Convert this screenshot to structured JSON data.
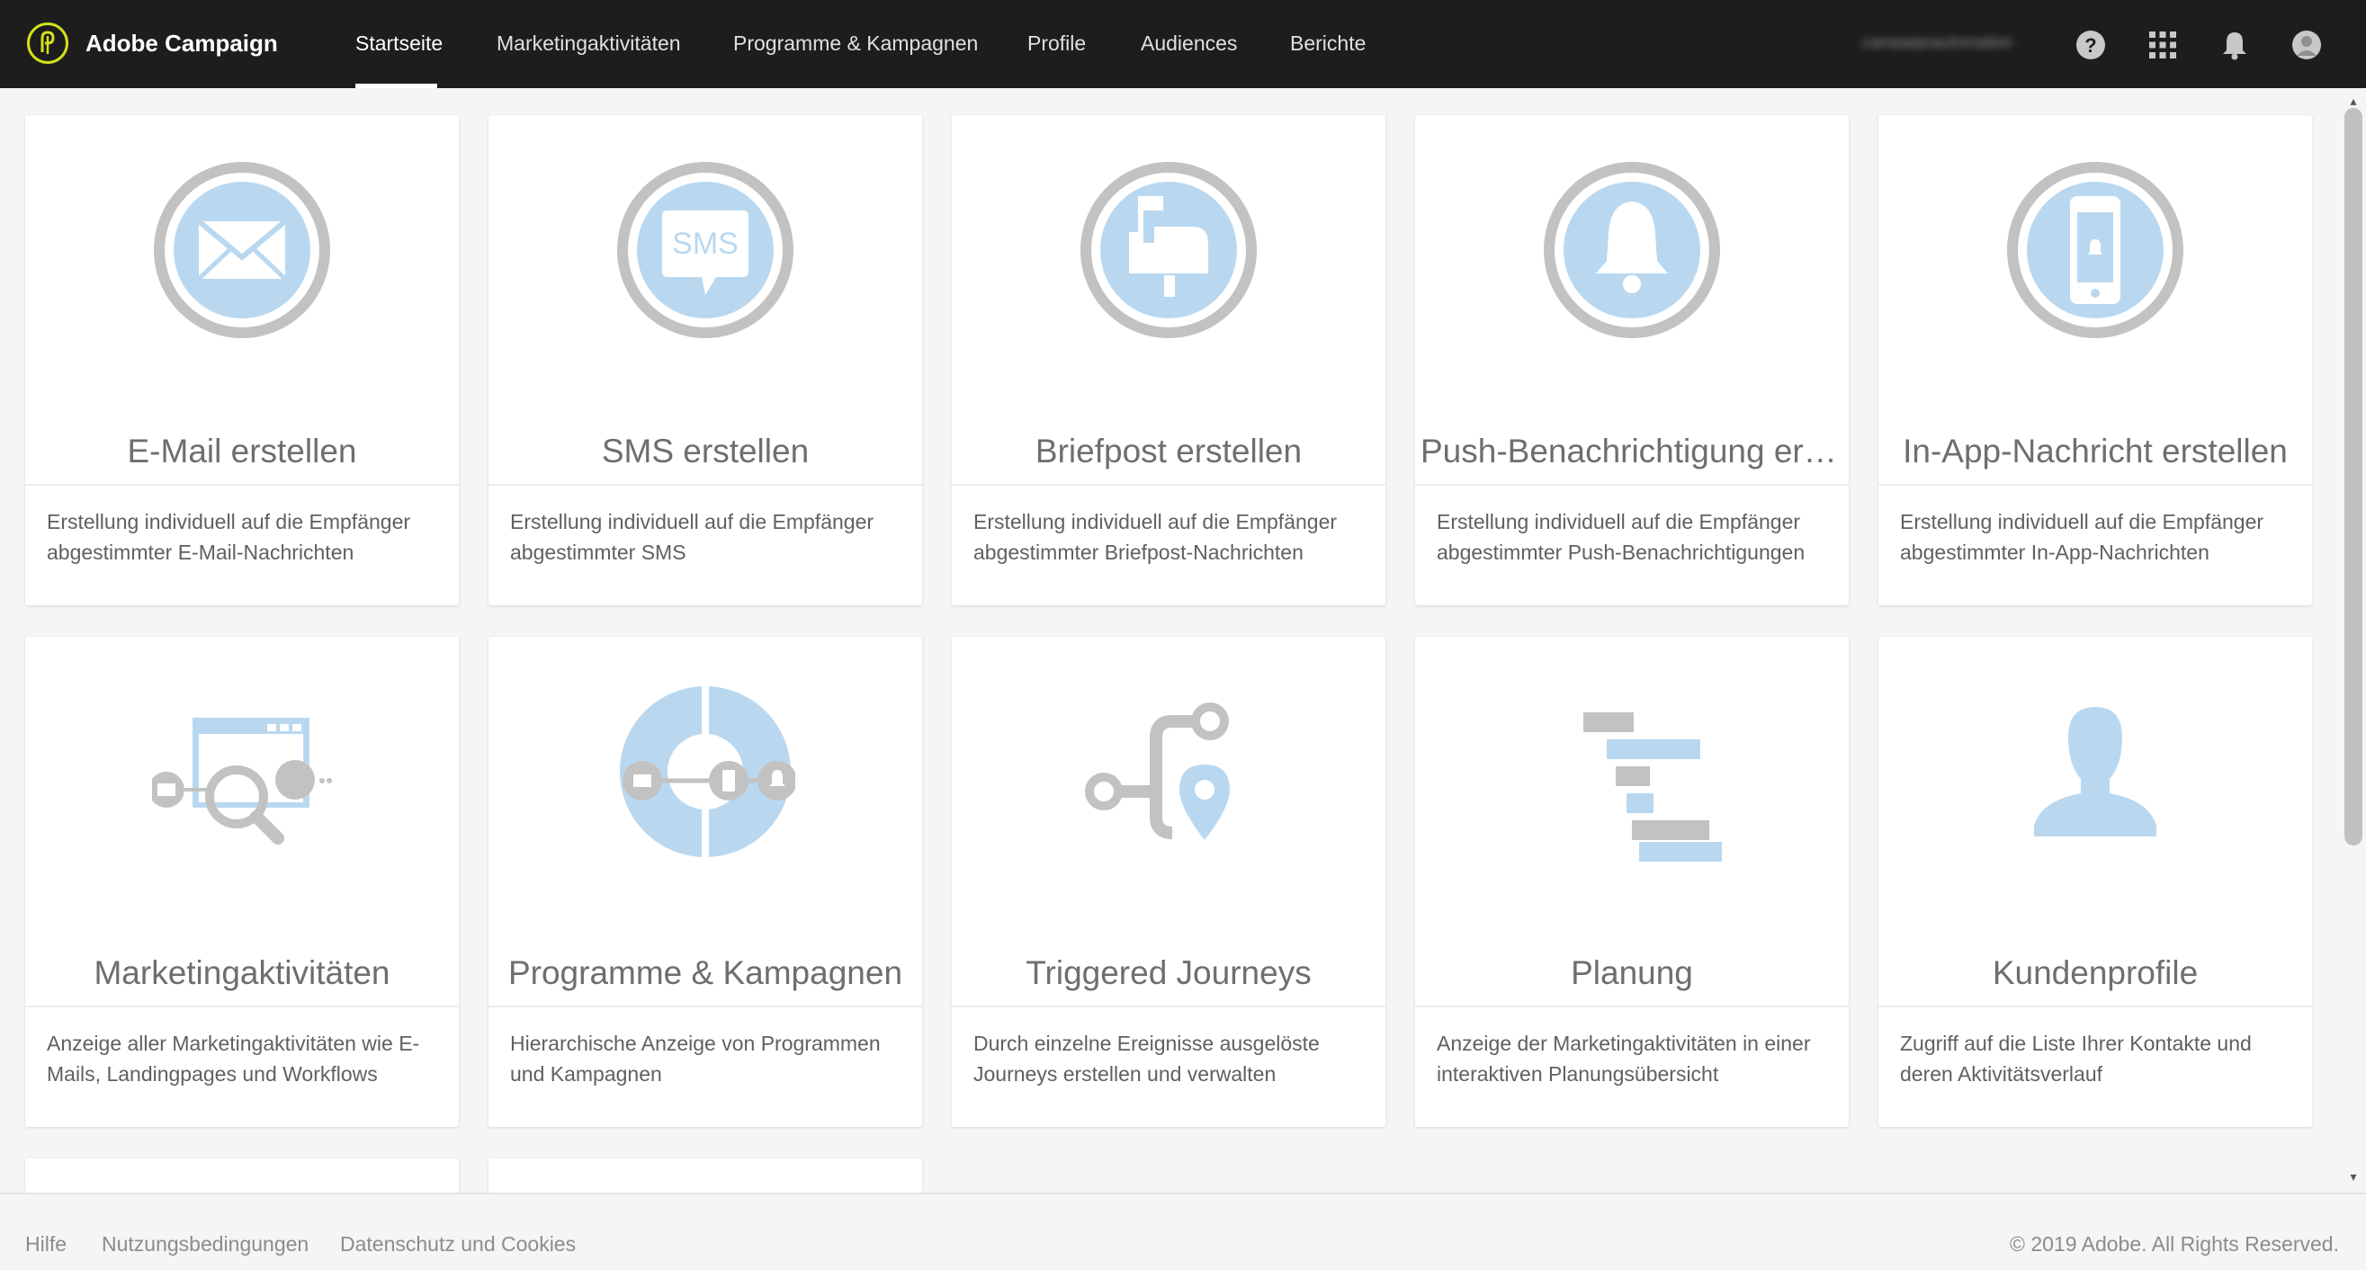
{
  "header": {
    "brand": "Adobe Campaign",
    "nav": [
      {
        "label": "Startseite",
        "active": true
      },
      {
        "label": "Marketingaktivitäten"
      },
      {
        "label": "Programme & Kampagnen"
      },
      {
        "label": "Profile"
      },
      {
        "label": "Audiences"
      },
      {
        "label": "Berichte"
      }
    ],
    "org_name": "campaignautomation",
    "icons": [
      "help-icon",
      "apps-grid-icon",
      "notification-bell-icon",
      "user-avatar-icon"
    ]
  },
  "cards": [
    {
      "title": "E-Mail erstellen",
      "description": "Erstellung individuell auf die Empfänger abgestimmter E-Mail-Nachrichten",
      "icon": "email-icon"
    },
    {
      "title": "SMS erstellen",
      "description": "Erstellung individuell auf die Empfänger abgestimmter SMS",
      "icon": "sms-icon",
      "icon_text": "SMS"
    },
    {
      "title": "Briefpost erstellen",
      "description": "Erstellung individuell auf die Empfänger abgestimmter Briefpost-Nachrichten",
      "icon": "mailbox-icon"
    },
    {
      "title": "Push-Benachrichtigung erstellen",
      "description": "Erstellung individuell auf die Empfänger abgestimmter Push-Benachrichtigungen",
      "icon": "push-bell-icon"
    },
    {
      "title": "In-App-Nachricht erstellen",
      "description": "Erstellung individuell auf die Empfänger abgestimmter In-App-Nachrichten",
      "icon": "in-app-phone-icon"
    },
    {
      "title": "Marketingaktivitäten",
      "description": "Anzeige aller Marketingaktivitäten wie E-Mails, Landingpages und Workflows",
      "icon": "marketing-activities-icon"
    },
    {
      "title": "Programme & Kampagnen",
      "description": "Hierarchische Anzeige von Programmen und Kampagnen",
      "icon": "programs-campaigns-icon"
    },
    {
      "title": "Triggered Journeys",
      "description": "Durch einzelne Ereignisse ausgelöste Journeys erstellen und verwalten",
      "icon": "journey-icon"
    },
    {
      "title": "Planung",
      "description": "Anzeige der Marketingaktivitäten in einer interaktiven Planungsübersicht",
      "icon": "gantt-planning-icon"
    },
    {
      "title": "Kundenprofile",
      "description": "Zugriff auf die Liste Ihrer Kontakte und deren Aktivitätsverlauf",
      "icon": "customer-profile-icon"
    }
  ],
  "footer": {
    "links": [
      "Hilfe",
      "Nutzungsbedingungen",
      "Datenschutz und Cookies"
    ],
    "copyright": "© 2019 Adobe. All Rights Reserved."
  },
  "colors": {
    "header_bg": "#1d1d1d",
    "logo_accent": "#d4e01c",
    "icon_blue": "#b9d8f0",
    "icon_gray": "#c2c2c2",
    "page_bg": "#f5f5f5"
  }
}
